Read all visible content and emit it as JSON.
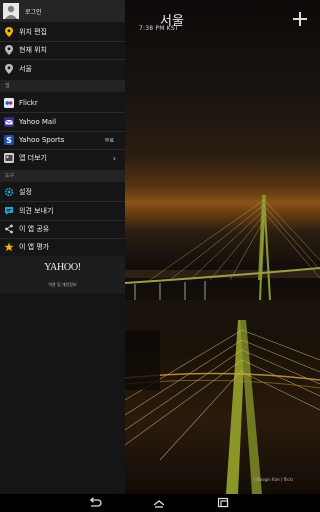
{
  "main": {
    "city": "서울",
    "time": "7:38 PM KST",
    "photo_credit": "ⓒBaegin Kim | flickr"
  },
  "drawer": {
    "login": "로그인",
    "locations": [
      {
        "label": "위치 편집",
        "icon": "location-pin-yellow"
      },
      {
        "label": "현재 위치",
        "icon": "location-pin-gray"
      },
      {
        "label": "서울",
        "icon": "location-pin-gray"
      }
    ],
    "apps_header": "앱",
    "apps": [
      {
        "label": "Flickr",
        "icon": "flickr-icon"
      },
      {
        "label": "Yahoo Mail",
        "icon": "mail-icon"
      },
      {
        "label": "Yahoo Sports",
        "icon": "sports-icon",
        "badge": "무료"
      },
      {
        "label": "앱 더보기",
        "icon": "more-apps-icon"
      }
    ],
    "tools_header": "도구",
    "tools": [
      {
        "label": "설정",
        "icon": "gear-icon"
      },
      {
        "label": "의견 보내기",
        "icon": "feedback-icon"
      },
      {
        "label": "이 앱 공유",
        "icon": "share-icon"
      },
      {
        "label": "이 앱 평가",
        "icon": "star-icon"
      }
    ],
    "logo": "YAHOO!",
    "terms": "약관 및 개인정보"
  },
  "colors": {
    "drawer_bg": "#151515",
    "section_bg": "#232323",
    "accent_yellow": "#f2b600",
    "accent_cyan": "#21a9d6"
  }
}
